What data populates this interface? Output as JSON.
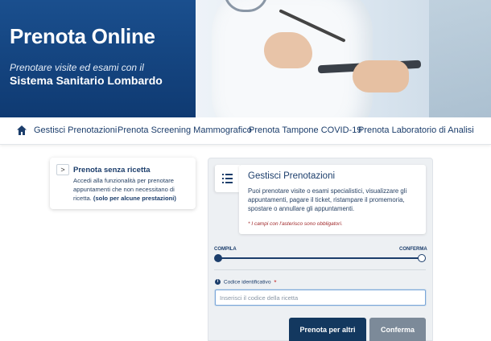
{
  "hero": {
    "title": "Prenota Online",
    "subtitle": "Prenotare visite ed esami con il",
    "system": "Sistema Sanitario Lombardo"
  },
  "nav": {
    "items": [
      {
        "label": "Gestisci Prenotazioni"
      },
      {
        "label": "Prenota Screening Mammografico"
      },
      {
        "label": "Prenota Tampone COVID-19"
      },
      {
        "label": "Prenota Laboratorio di Analisi"
      }
    ]
  },
  "side_card": {
    "chevron": ">",
    "title": "Prenota senza ricetta",
    "text": "Accedi alla funzionalità per prenotare appuntamenti che non necessitano di ricetta.",
    "note": "(solo per alcune prestazioni)"
  },
  "main": {
    "title": "Gestisci Prenotazioni",
    "description": "Puoi prenotare visite o esami specialistici, visualizzare gli appuntamenti, pagare il ticket, ristampare il promemoria, spostare o annullare gli appuntamenti.",
    "required_note": "* I campi con l'asterisco sono obbligatori.",
    "steps": {
      "start": "COMPILA",
      "end": "CONFERMA"
    },
    "field": {
      "label": "Codice identificativo",
      "asterisk": "*",
      "info": "i",
      "placeholder": "Inserisci il codice della ricetta",
      "value": ""
    },
    "buttons": {
      "primary": "Prenota per altri",
      "secondary": "Conferma"
    }
  },
  "colors": {
    "primary": "#13385f",
    "hero": "#123f7a",
    "secondary_button": "#7c8a99",
    "required": "#a0282a"
  },
  "icons": [
    "home-icon",
    "list-icon",
    "info-icon"
  ]
}
